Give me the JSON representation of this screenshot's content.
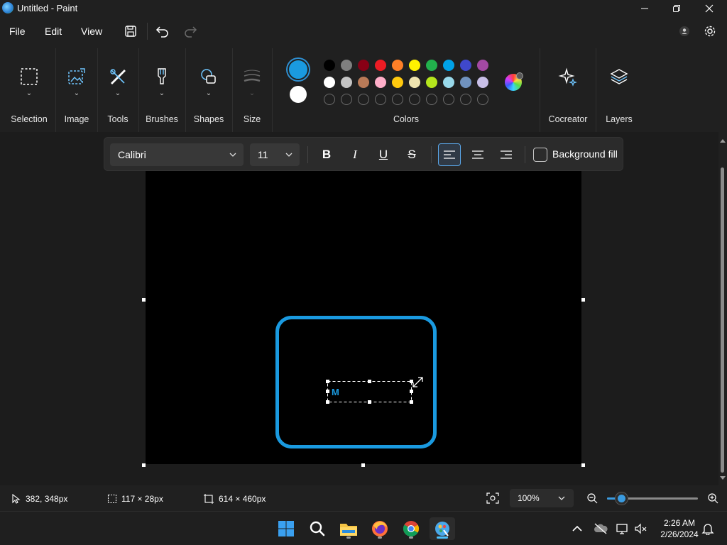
{
  "window": {
    "title": "Untitled - Paint"
  },
  "menu": {
    "file": "File",
    "edit": "Edit",
    "view": "View"
  },
  "ribbon": {
    "groups": [
      {
        "label": "Selection",
        "icon": "selection-icon"
      },
      {
        "label": "Image",
        "icon": "image-icon"
      },
      {
        "label": "Tools",
        "icon": "tools-icon"
      },
      {
        "label": "Brushes",
        "icon": "brush-icon"
      },
      {
        "label": "Shapes",
        "icon": "shapes-icon"
      },
      {
        "label": "Size",
        "icon": "size-icon"
      }
    ],
    "colors_label": "Colors",
    "cocreator_label": "Cocreator",
    "layers_label": "Layers",
    "primary_color": "#1a9ae0",
    "secondary_color": "#ffffff",
    "palette_row1": [
      "#000000",
      "#7f7f7f",
      "#880015",
      "#ed1c24",
      "#ff7f27",
      "#fff200",
      "#22b14c",
      "#00a2e8",
      "#3f48cc",
      "#a349a4"
    ],
    "palette_row2": [
      "#ffffff",
      "#c3c3c3",
      "#b97a57",
      "#ffaec9",
      "#ffc90e",
      "#efe4b0",
      "#b5e61d",
      "#99d9ea",
      "#7092be",
      "#c8bfe7"
    ]
  },
  "text_toolbar": {
    "font": "Calibri",
    "size": "11",
    "bold": "B",
    "italic": "I",
    "underline": "U",
    "strikethrough": "S",
    "background_fill": "Background fill"
  },
  "canvas": {
    "text_content": "M",
    "shape_color": "#1a9ae0"
  },
  "status": {
    "cursor_position": "382, 348px",
    "selection_size": "117 × 28px",
    "canvas_size": "614 × 460px",
    "zoom": "100%",
    "zoom_level": 0.16
  },
  "taskbar": {
    "time": "2:26 AM",
    "date": "2/26/2024"
  }
}
